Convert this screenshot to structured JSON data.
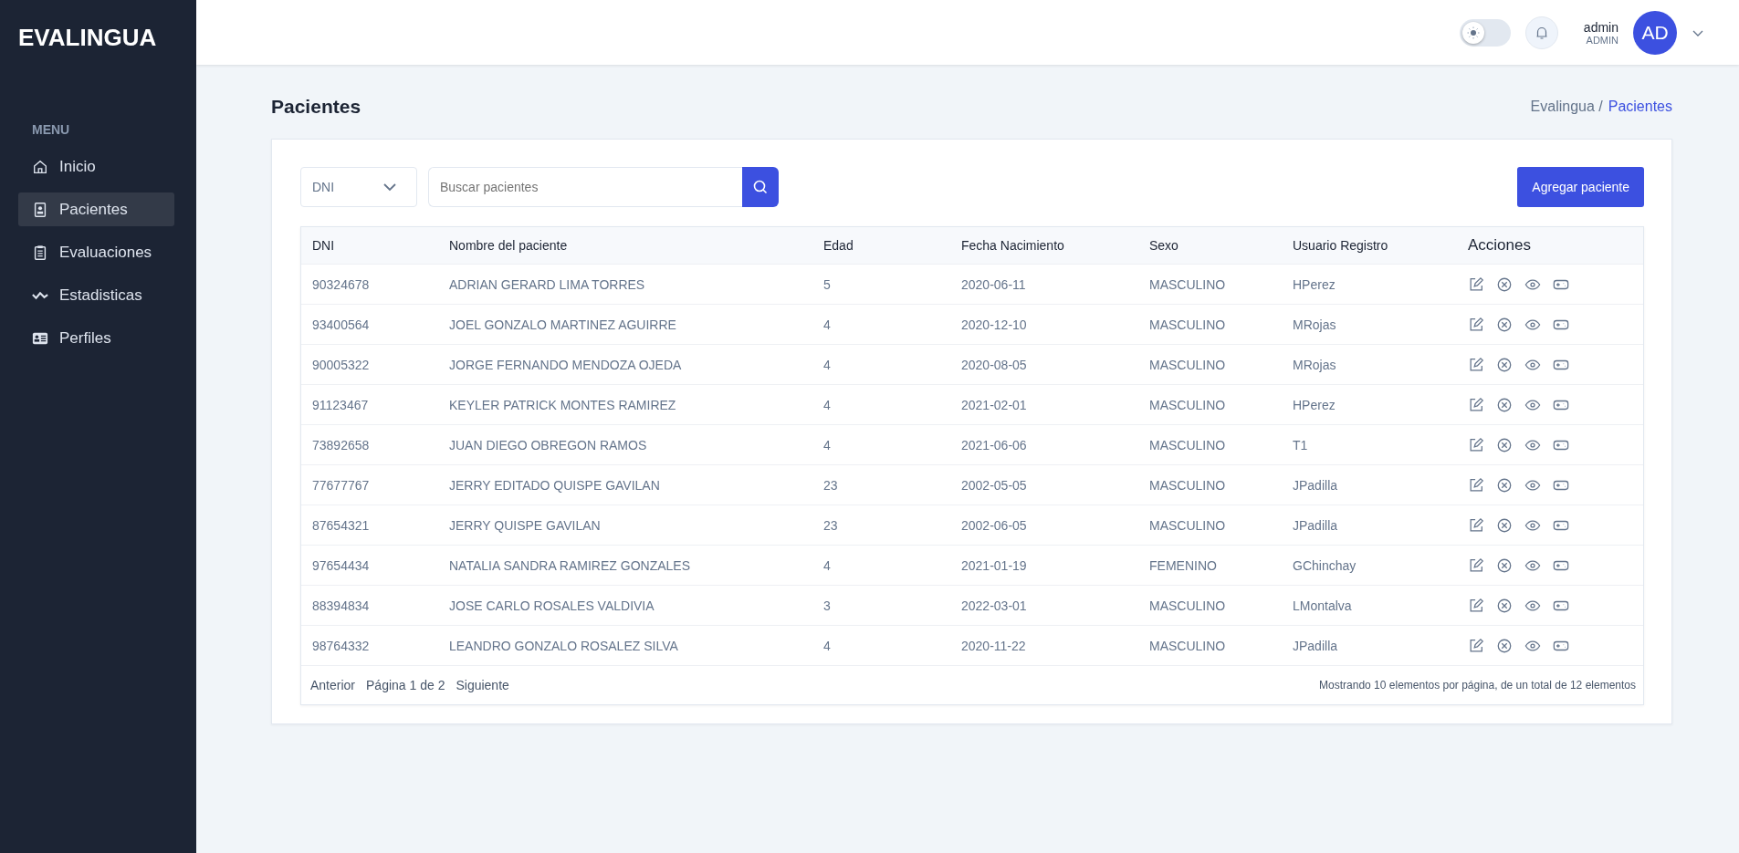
{
  "sidebar": {
    "logo": "EVALINGUA",
    "menu_title": "MENU",
    "items": [
      {
        "label": "Inicio",
        "selected": false
      },
      {
        "label": "Pacientes",
        "selected": true
      },
      {
        "label": "Evaluaciones",
        "selected": false
      },
      {
        "label": "Estadisticas",
        "selected": false
      },
      {
        "label": "Perfiles",
        "selected": false
      }
    ]
  },
  "header": {
    "theme_toggle": {
      "on": false
    },
    "user": {
      "name": "admin",
      "role": "ADMIN",
      "initials": "AD"
    }
  },
  "page": {
    "title": "Pacientes",
    "breadcrumb": [
      {
        "label": "Evalingua /",
        "selected": false
      },
      {
        "label": "Pacientes",
        "selected": true
      }
    ]
  },
  "filter": {
    "select": "DNI",
    "search": {
      "placeholder": "Buscar pacientes"
    },
    "add_button": "Agregar paciente"
  },
  "table": {
    "columns": [
      "DNI",
      "Nombre del paciente",
      "Edad",
      "Fecha Nacimiento",
      "Sexo",
      "Usuario Registro",
      "Acciones"
    ],
    "rows": [
      [
        "90324678",
        "ADRIAN GERARD LIMA TORRES",
        "5",
        "2020-06-11",
        "MASCULINO",
        "HPerez"
      ],
      [
        "93400564",
        "JOEL GONZALO MARTINEZ AGUIRRE",
        "4",
        "2020-12-10",
        "MASCULINO",
        "MRojas"
      ],
      [
        "90005322",
        "JORGE FERNANDO MENDOZA OJEDA",
        "4",
        "2020-08-05",
        "MASCULINO",
        "MRojas"
      ],
      [
        "91123467",
        "KEYLER PATRICK MONTES RAMIREZ",
        "4",
        "2021-02-01",
        "MASCULINO",
        "HPerez"
      ],
      [
        "73892658",
        "JUAN DIEGO OBREGON RAMOS",
        "4",
        "2021-06-06",
        "MASCULINO",
        "T1"
      ],
      [
        "77677767",
        "JERRY EDITADO QUISPE GAVILAN",
        "23",
        "2002-05-05",
        "MASCULINO",
        "JPadilla"
      ],
      [
        "87654321",
        "JERRY QUISPE GAVILAN",
        "23",
        "2002-06-05",
        "MASCULINO",
        "JPadilla"
      ],
      [
        "97654434",
        "NATALIA SANDRA RAMIREZ GONZALES",
        "4",
        "2021-01-19",
        "FEMENINO",
        "GChinchay"
      ],
      [
        "88394834",
        "JOSE CARLO ROSALES VALDIVIA",
        "3",
        "2022-03-01",
        "MASCULINO",
        "LMontalva"
      ],
      [
        "98764332",
        "LEANDRO GONZALO ROSALEZ SILVA",
        "4",
        "2020-11-22",
        "MASCULINO",
        "JPadilla"
      ]
    ]
  },
  "pagination": {
    "previous": "Anterior",
    "page": "Página 1 de 2",
    "next": "Siguiente",
    "summary": "Mostrando 10 elementos por página, de un total de 12 elementos"
  }
}
